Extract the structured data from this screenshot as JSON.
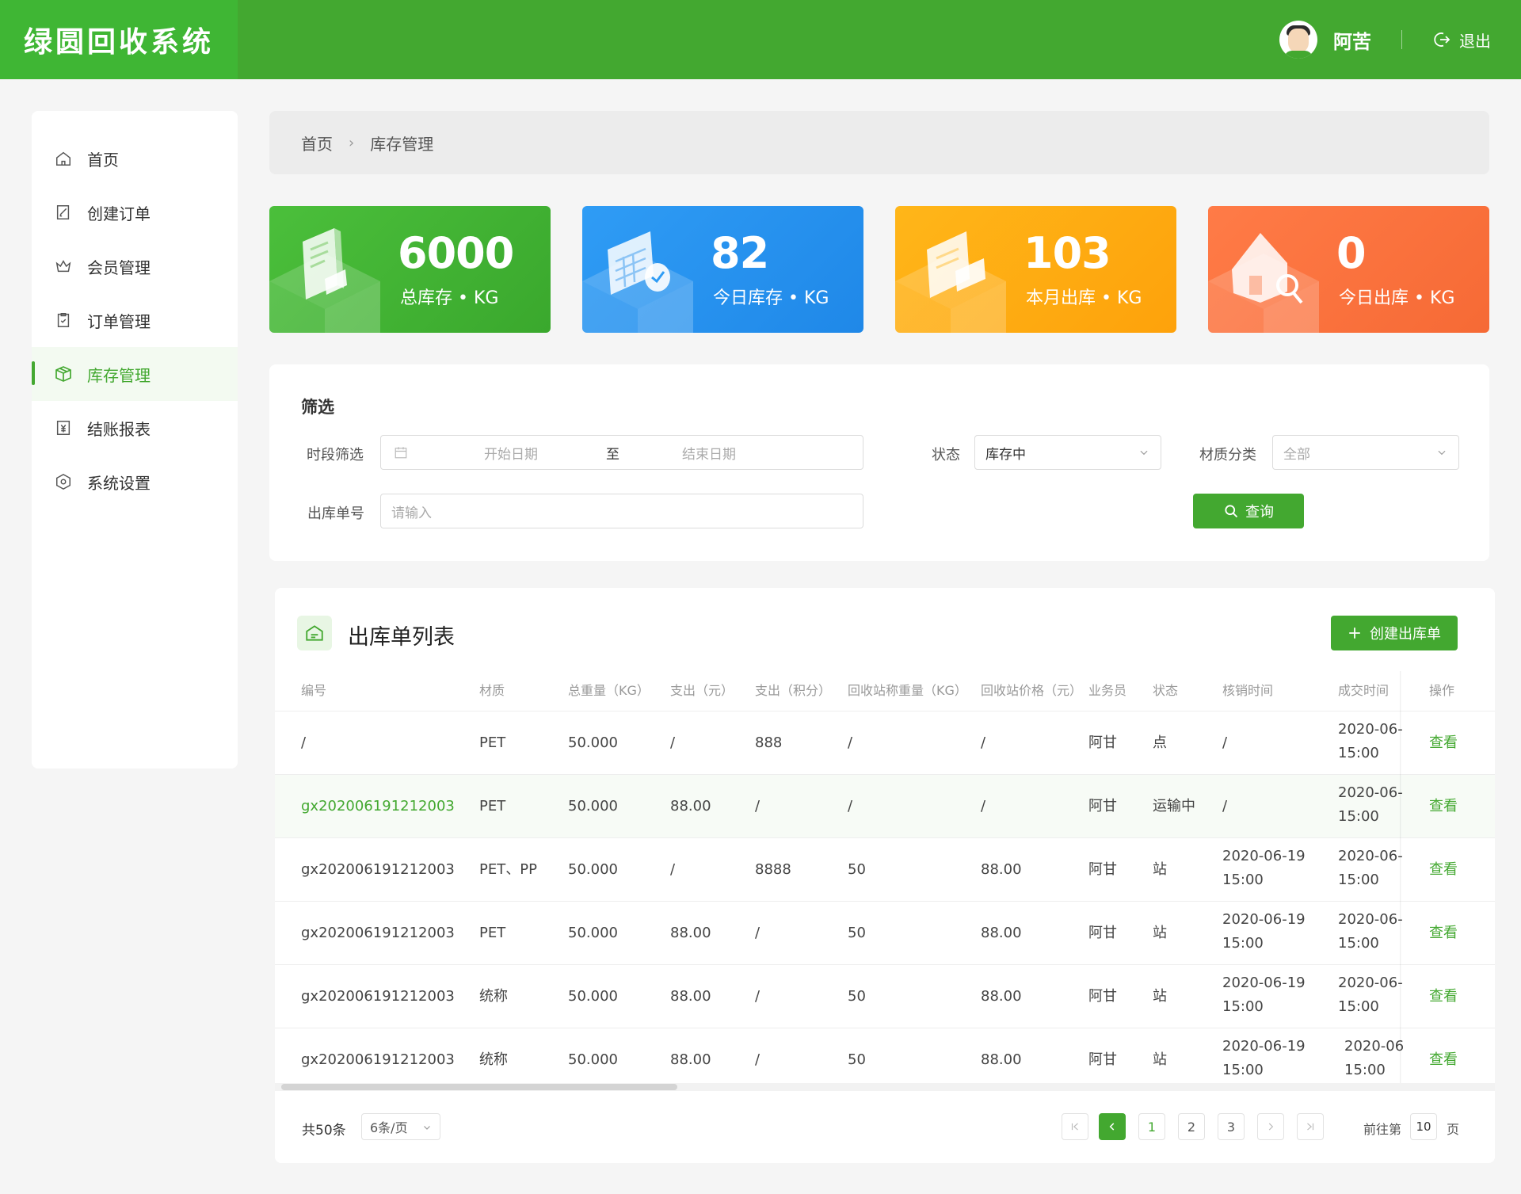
{
  "app": {
    "title": "绿圆回收系统"
  },
  "user": {
    "name": "阿苦",
    "logout_label": "退出"
  },
  "sidebar": {
    "items": [
      {
        "label": "首页",
        "icon": "home-icon"
      },
      {
        "label": "创建订单",
        "icon": "edit-icon"
      },
      {
        "label": "会员管理",
        "icon": "crown-icon"
      },
      {
        "label": "订单管理",
        "icon": "clipboard-icon"
      },
      {
        "label": "库存管理",
        "icon": "box-icon",
        "active": true
      },
      {
        "label": "结账报表",
        "icon": "yen-icon"
      },
      {
        "label": "系统设置",
        "icon": "settings-icon"
      }
    ]
  },
  "breadcrumb": {
    "home": "首页",
    "sep": "›",
    "current": "库存管理"
  },
  "stats": [
    {
      "value": "6000",
      "label": "总库存 • KG",
      "color": "#43a830"
    },
    {
      "value": "82",
      "label": "今日库存 • KG",
      "color": "#2196f3"
    },
    {
      "value": "103",
      "label": "本月出库 • KG",
      "color": "#ffab12"
    },
    {
      "value": "0",
      "label": "今日出库 • KG",
      "color": "#f7713c"
    }
  ],
  "filter": {
    "title": "筛选",
    "period_label": "时段筛选",
    "start_placeholder": "开始日期",
    "to": "至",
    "end_placeholder": "结束日期",
    "status_label": "状态",
    "status_value": "库存中",
    "material_label": "材质分类",
    "material_value": "全部",
    "order_label": "出库单号",
    "order_placeholder": "请输入",
    "query_button": "查询"
  },
  "table": {
    "title": "出库单列表",
    "create_button": "创建出库单",
    "headers": [
      "编号",
      "材质",
      "总重量（KG）",
      "支出（元）",
      "支出（积分）",
      "回收站称重量（KG）",
      "回收站价格（元）",
      "业务员",
      "状态",
      "核销时间",
      "成交时间",
      "操作"
    ],
    "rows": [
      {
        "id": "/",
        "material": "PET",
        "weight": "50.000",
        "cost": "/",
        "points": "888",
        "station_weight": "/",
        "station_price": "/",
        "staff": "阿甘",
        "status": "点",
        "verify_l1": "/",
        "verify_l2": "",
        "deal_l1": "2020-06-",
        "deal_l2": "15:00",
        "action": "查看"
      },
      {
        "id": "gx202006191212003",
        "material": "PET",
        "weight": "50.000",
        "cost": "88.00",
        "points": "/",
        "station_weight": "/",
        "station_price": "/",
        "staff": "阿甘",
        "status": "运输中",
        "verify_l1": "/",
        "verify_l2": "",
        "deal_l1": "2020-06-",
        "deal_l2": "15:00",
        "action": "查看"
      },
      {
        "id": "gx202006191212003",
        "material": "PET、PP",
        "weight": "50.000",
        "cost": "/",
        "points": "8888",
        "station_weight": "50",
        "station_price": "88.00",
        "staff": "阿甘",
        "status": "站",
        "verify_l1": "2020-06-19",
        "verify_l2": "15:00",
        "deal_l1": "2020-06-",
        "deal_l2": "15:00",
        "action": "查看"
      },
      {
        "id": "gx202006191212003",
        "material": "PET",
        "weight": "50.000",
        "cost": "88.00",
        "points": "/",
        "station_weight": "50",
        "station_price": "88.00",
        "staff": "阿甘",
        "status": "站",
        "verify_l1": "2020-06-19",
        "verify_l2": "15:00",
        "deal_l1": "2020-06-",
        "deal_l2": "15:00",
        "action": "查看"
      },
      {
        "id": "gx202006191212003",
        "material": "统称",
        "weight": "50.000",
        "cost": "88.00",
        "points": "/",
        "station_weight": "50",
        "station_price": "88.00",
        "staff": "阿甘",
        "status": "站",
        "verify_l1": "2020-06-19",
        "verify_l2": "15:00",
        "deal_l1": "2020-06-",
        "deal_l2": "15:00",
        "action": "查看"
      },
      {
        "id": "gx202006191212003",
        "material": "统称",
        "weight": "50.000",
        "cost": "88.00",
        "points": "/",
        "station_weight": "50",
        "station_price": "88.00",
        "staff": "阿甘",
        "status": "站",
        "verify_l1": "2020-06-19",
        "verify_l2": "15:00",
        "deal_l1": "2020-06",
        "deal_l2": "15:00",
        "action": "查看"
      }
    ]
  },
  "pagination": {
    "total": "共50条",
    "page_size": "6条/页",
    "pages": [
      "1",
      "2",
      "3"
    ],
    "goto_prefix": "前往第",
    "goto_value": "10",
    "goto_suffix": "页"
  }
}
